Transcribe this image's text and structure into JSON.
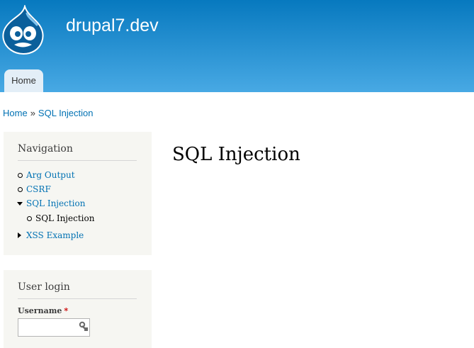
{
  "header": {
    "site_name": "drupal7.dev",
    "gradient_top": "#0779bf",
    "gradient_bottom": "#48a9e4",
    "logo_icon": "drupal-drop-icon"
  },
  "main_menu": {
    "items": [
      {
        "label": "Home",
        "active": true
      }
    ]
  },
  "breadcrumb": {
    "items": [
      "Home",
      "SQL Injection"
    ],
    "separator": "»"
  },
  "sidebar": {
    "navigation": {
      "title": "Navigation",
      "items": [
        {
          "label": "Arg Output",
          "marker": "bullet-icon"
        },
        {
          "label": "CSRF",
          "marker": "bullet-icon"
        },
        {
          "label": "SQL Injection",
          "marker": "expanded-arrow-icon",
          "children": [
            {
              "label": "SQL Injection",
              "marker": "bullet-icon",
              "active": true
            }
          ]
        },
        {
          "label": "XSS Example",
          "marker": "collapsed-arrow-icon"
        }
      ]
    },
    "user_login": {
      "title": "User login",
      "username_label": "Username",
      "required_marker": "*",
      "username_value": ""
    }
  },
  "content": {
    "title": "SQL Injection"
  },
  "colors": {
    "link": "#0071b3",
    "sidebar_bg": "#f6f6f2",
    "tab_bg": "#e3eef7",
    "required": "#cc0000"
  }
}
